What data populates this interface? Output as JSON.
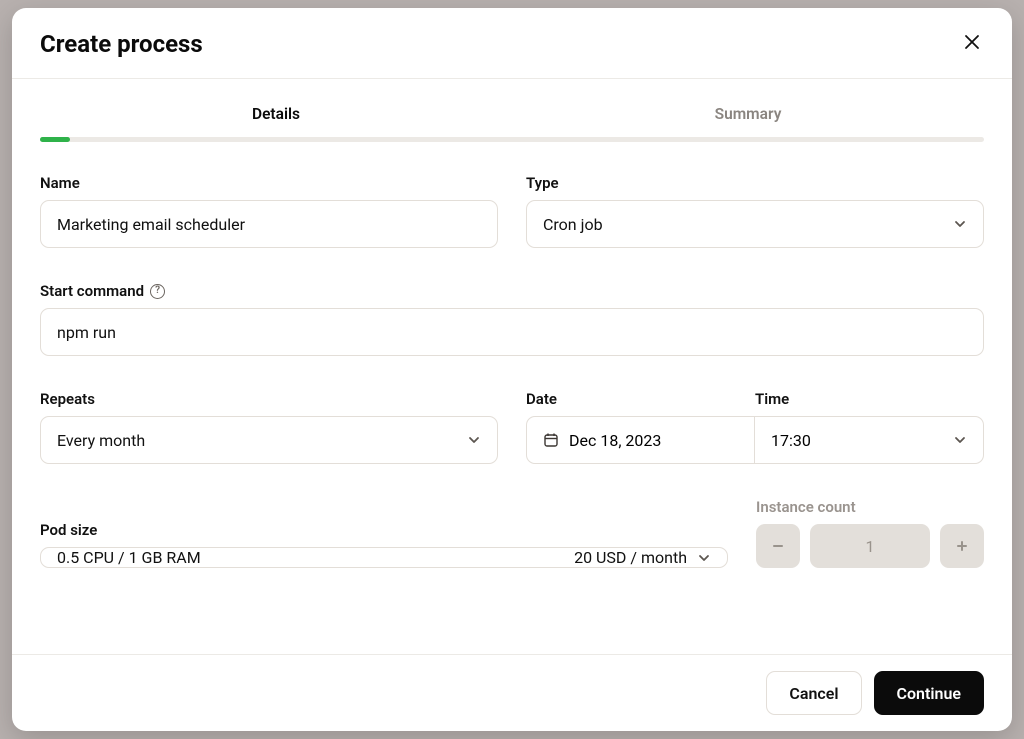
{
  "modal": {
    "title": "Create process",
    "tabs": {
      "details": "Details",
      "summary": "Summary"
    }
  },
  "form": {
    "name": {
      "label": "Name",
      "value": "Marketing email scheduler"
    },
    "type": {
      "label": "Type",
      "value": "Cron job"
    },
    "start_command": {
      "label": "Start command",
      "value": "npm run"
    },
    "repeats": {
      "label": "Repeats",
      "value": "Every month"
    },
    "date": {
      "label": "Date",
      "value": "Dec 18, 2023"
    },
    "time": {
      "label": "Time",
      "value": "17:30"
    },
    "pod_size": {
      "label": "Pod size",
      "value": "0.5 CPU / 1 GB RAM",
      "price": "20 USD / month"
    },
    "instance_count": {
      "label": "Instance count",
      "value": "1"
    }
  },
  "footer": {
    "cancel": "Cancel",
    "continue": "Continue"
  }
}
